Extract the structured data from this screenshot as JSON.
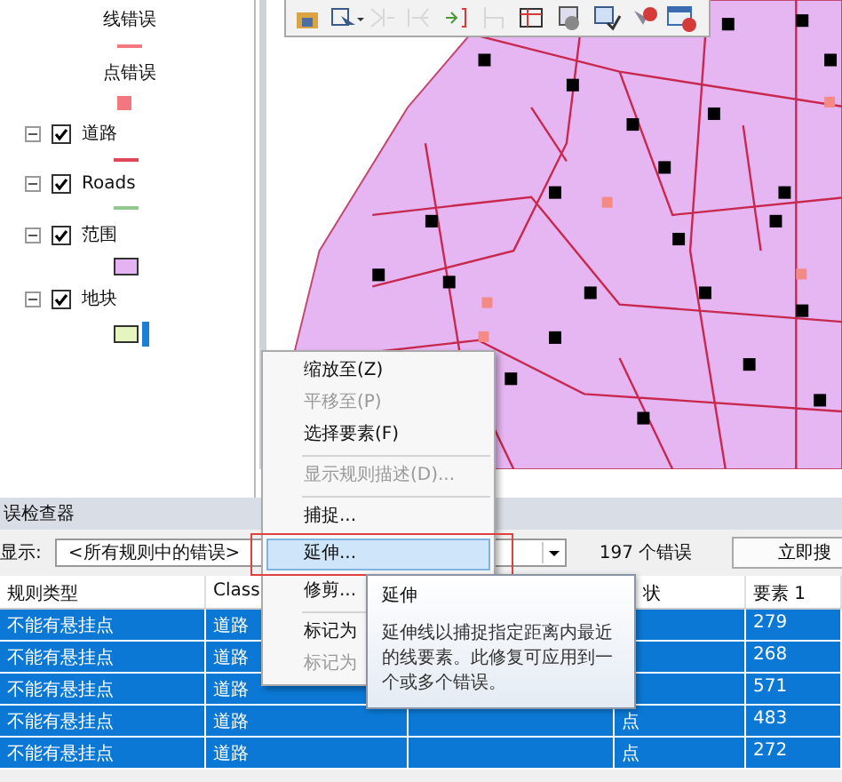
{
  "legend": [
    {
      "kind": "error_line",
      "label": "线错误",
      "color": "#f4777f"
    },
    {
      "kind": "error_point",
      "label": "点错误",
      "color": "#f4777f"
    },
    {
      "kind": "layer_line",
      "label": "道路",
      "expanded": true,
      "checked": true,
      "color": "#e0475a"
    },
    {
      "kind": "layer_line",
      "label": "Roads",
      "expanded": true,
      "checked": true,
      "color": "#93c98f"
    },
    {
      "kind": "layer_polygon",
      "label": "范围",
      "expanded": true,
      "checked": true,
      "color": "#e6b3f2"
    },
    {
      "kind": "layer_polygon_bar",
      "label": "地块",
      "expanded": true,
      "checked": true,
      "color": "#e6f5bd"
    }
  ],
  "toolbar": [
    {
      "kind": "catalog",
      "disabled": false
    },
    {
      "kind": "select_menu",
      "disabled": false
    },
    {
      "kind": "extend",
      "disabled": true
    },
    {
      "kind": "trim",
      "disabled": true
    },
    {
      "kind": "merge",
      "disabled": false
    },
    {
      "kind": "split",
      "disabled": true
    },
    {
      "kind": "table",
      "disabled": false
    },
    {
      "kind": "validate",
      "disabled": false
    },
    {
      "kind": "check",
      "disabled": false
    },
    {
      "kind": "error_point",
      "disabled": false
    },
    {
      "kind": "error_window",
      "disabled": false
    }
  ],
  "inspector": {
    "title": "误检查器",
    "show_label": "显示:",
    "filter": "<所有规则中的错误>",
    "count": "197 个错误",
    "search_button": "立即搜",
    "columns": [
      "规则类型",
      "Class",
      "状",
      "要素 1"
    ],
    "rows": [
      {
        "rule_type": "不能有悬挂点",
        "class": "道路",
        "feature": "279",
        "selected": true
      },
      {
        "rule_type": "不能有悬挂点",
        "class": "道路",
        "feature": "268",
        "selected": true
      },
      {
        "rule_type": "不能有悬挂点",
        "class": "道路",
        "feature": "571",
        "selected": true
      },
      {
        "rule_type": "不能有悬挂点",
        "class": "道路",
        "shape": "点",
        "feature": "483",
        "selected": true
      },
      {
        "rule_type": "不能有悬挂点",
        "class": "道路",
        "shape": "点",
        "feature": "272",
        "selected": true
      }
    ]
  },
  "context_menu": [
    {
      "kind": "item",
      "label": "缩放至(Z)",
      "disabled": false,
      "selected": false
    },
    {
      "kind": "item",
      "label": "平移至(P)",
      "disabled": true,
      "selected": false
    },
    {
      "kind": "item",
      "label": "选择要素(F)",
      "disabled": false,
      "selected": false
    },
    {
      "kind": "separator"
    },
    {
      "kind": "item",
      "label": "显示规则描述(D)...",
      "disabled": true,
      "selected": false
    },
    {
      "kind": "separator"
    },
    {
      "kind": "item",
      "label": "捕捉...",
      "disabled": false,
      "selected": false
    },
    {
      "kind": "item",
      "label": "延伸...",
      "disabled": false,
      "selected": true,
      "marked": true
    },
    {
      "kind": "item",
      "label": "修剪...",
      "disabled": false,
      "selected": false
    },
    {
      "kind": "separator"
    },
    {
      "kind": "item",
      "label": "标记为",
      "disabled": false,
      "selected": false
    },
    {
      "kind": "item",
      "label": "标记为",
      "disabled": true,
      "selected": false
    }
  ],
  "tooltip": {
    "title": "延伸",
    "text": "延伸线以捕捉指定距离内最近的线要素。此修复可应用到一个或多个错误。"
  }
}
